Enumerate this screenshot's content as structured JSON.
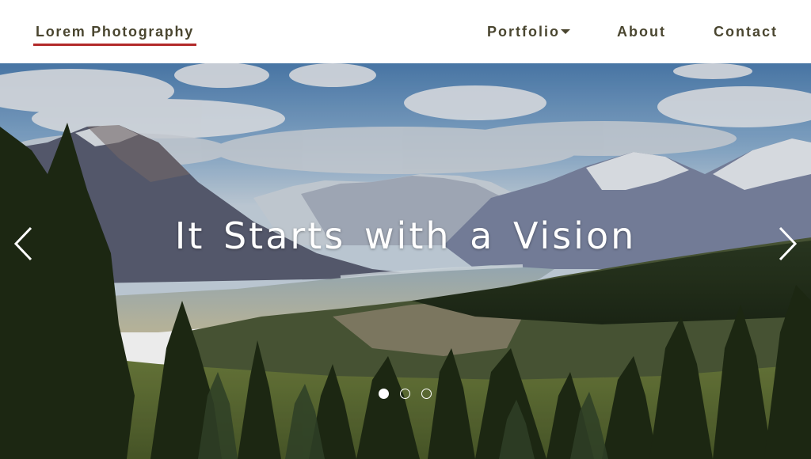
{
  "navbar": {
    "brand": "Lorem Photography",
    "items": [
      {
        "label": "Portfolio",
        "has_dropdown": true
      },
      {
        "label": "About"
      },
      {
        "label": "Contact"
      }
    ]
  },
  "hero": {
    "caption": "It Starts with a Vision",
    "slides_count": 3,
    "active_slide": 1,
    "prev_icon": "chevron-left-icon",
    "next_icon": "chevron-right-icon"
  },
  "colors": {
    "nav_text": "#4a4630",
    "brand_underline": "#b22a2a",
    "navbar_bg": "#ffffff",
    "caption_text": "#ffffff"
  }
}
